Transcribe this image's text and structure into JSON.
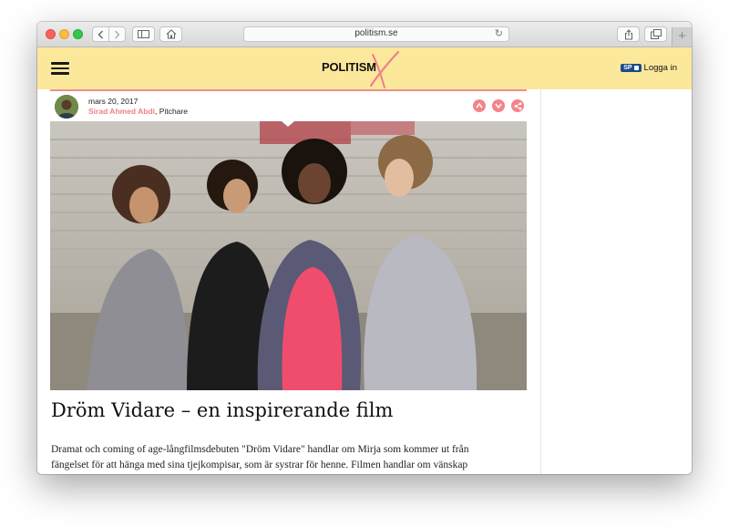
{
  "browser": {
    "url": "politism.se",
    "buttons": {
      "back": "back",
      "forward": "forward",
      "sidebar": "sidebar",
      "home": "home",
      "share": "share",
      "tabs": "tabs",
      "new_tab": "+"
    },
    "icons": {
      "back": "chevron-left-icon",
      "forward": "chevron-right-icon",
      "sidebar": "sidebar-icon",
      "home": "home-icon",
      "reload": "reload-icon",
      "share": "share-icon",
      "tabs": "tabs-icon"
    }
  },
  "site": {
    "logo_text": "POLITISM",
    "login_label": "Logga in",
    "sp_badge": "SP",
    "colors": {
      "header_bg": "#fce89b",
      "accent_pink": "#f4848a",
      "sp_blue": "#1b4c8c"
    }
  },
  "article": {
    "date": "mars 20, 2017",
    "author": "Sirad Ahmed Abdi",
    "role": ", Pitchare",
    "action_icons": [
      "arrow-up-icon",
      "arrow-down-icon",
      "share-icon"
    ],
    "title": "Dröm Vidare – en inspirerande film",
    "body_line1": "Dramat och coming of age-långfilmsdebuten \"Dröm Vidare\" handlar om Mirja som kommer ut från",
    "body_line2": "fängelset för att hänga med sina tjejkompisar, som är systrar för henne. Filmen handlar om vänskap"
  }
}
